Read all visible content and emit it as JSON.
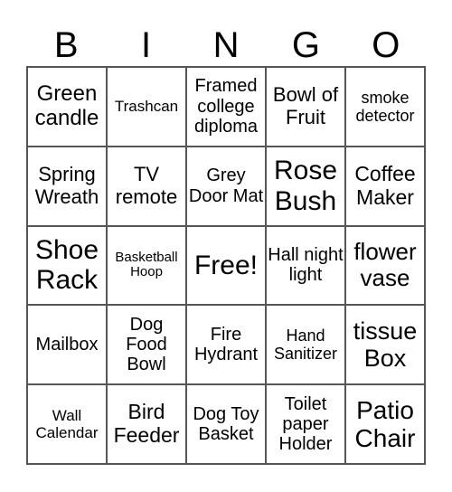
{
  "title_letters": [
    "B",
    "I",
    "N",
    "G",
    "O"
  ],
  "cells": [
    {
      "text": "Green candle",
      "size": 24
    },
    {
      "text": "Trashcan",
      "size": 17
    },
    {
      "text": "Framed college diploma",
      "size": 20
    },
    {
      "text": "Bowl of Fruit",
      "size": 22
    },
    {
      "text": "smoke detector",
      "size": 18
    },
    {
      "text": "Spring Wreath",
      "size": 22
    },
    {
      "text": "TV remote",
      "size": 22
    },
    {
      "text": "Grey Door Mat",
      "size": 20
    },
    {
      "text": "Rose Bush",
      "size": 30
    },
    {
      "text": "Coffee Maker",
      "size": 23
    },
    {
      "text": "Shoe Rack",
      "size": 30
    },
    {
      "text": "Basketball Hoop",
      "size": 15
    },
    {
      "text": "Free!",
      "size": 30
    },
    {
      "text": "Hall night light",
      "size": 20
    },
    {
      "text": "flower vase",
      "size": 26
    },
    {
      "text": "Mailbox",
      "size": 20
    },
    {
      "text": "Dog Food Bowl",
      "size": 20
    },
    {
      "text": "Fire Hydrant",
      "size": 20
    },
    {
      "text": "Hand Sanitizer",
      "size": 18
    },
    {
      "text": "tissue Box",
      "size": 27
    },
    {
      "text": "Wall Calendar",
      "size": 17
    },
    {
      "text": "Bird Feeder",
      "size": 23
    },
    {
      "text": "Dog Toy Basket",
      "size": 20
    },
    {
      "text": "Toilet paper Holder",
      "size": 20
    },
    {
      "text": "Patio Chair",
      "size": 28
    }
  ]
}
